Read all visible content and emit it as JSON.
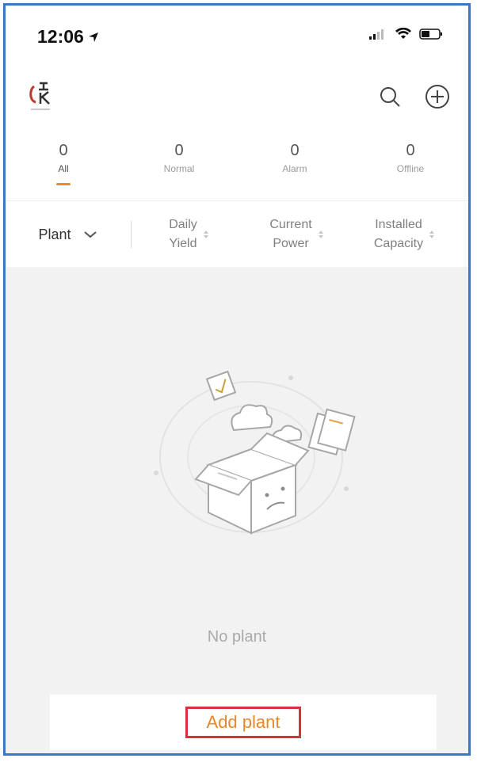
{
  "status_bar": {
    "time": "12:06"
  },
  "header": {
    "logo_icon": "brand-logo",
    "search_icon": "search-icon",
    "add_icon": "plus-circle-icon"
  },
  "summary": [
    {
      "count": "0",
      "label": "All",
      "active": true
    },
    {
      "count": "0",
      "label": "Normal"
    },
    {
      "count": "0",
      "label": "Alarm"
    },
    {
      "count": "0",
      "label": "Offline"
    }
  ],
  "columns": {
    "plant": "Plant",
    "daily_yield_1": "Daily",
    "daily_yield_2": "Yield",
    "current_power_1": "Current",
    "current_power_2": "Power",
    "installed_capacity_1": "Installed",
    "installed_capacity_2": "Capacity"
  },
  "empty_state": {
    "text": "No plant",
    "illustration_icon": "empty-box-illustration"
  },
  "add_button": {
    "label": "Add plant"
  },
  "colors": {
    "accent": "#f08a24",
    "highlight_border": "#d9303e",
    "frame": "#3f74c9"
  }
}
